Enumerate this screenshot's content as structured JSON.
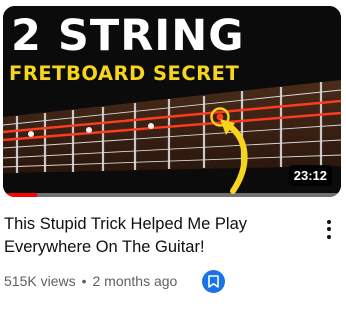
{
  "thumbnail": {
    "headline": "2 STRING",
    "subheadline": "FRETBOARD SECRET",
    "duration": "23:12",
    "watch_progress": 0.1
  },
  "video": {
    "title": "This Stupid Trick Helped Me Play Everywhere On The Guitar!",
    "views": "515K views",
    "separator": "•",
    "age": "2 months ago"
  },
  "icons": {
    "menu": "more-vert-icon",
    "save": "bookmark-icon",
    "annotation": "arrow-icon"
  },
  "colors": {
    "headline": "#ffffff",
    "subheadline": "#f7d51d",
    "string_highlight": "#ff3b1f",
    "progress": "#ff0000",
    "save_button": "#1a73e8"
  }
}
